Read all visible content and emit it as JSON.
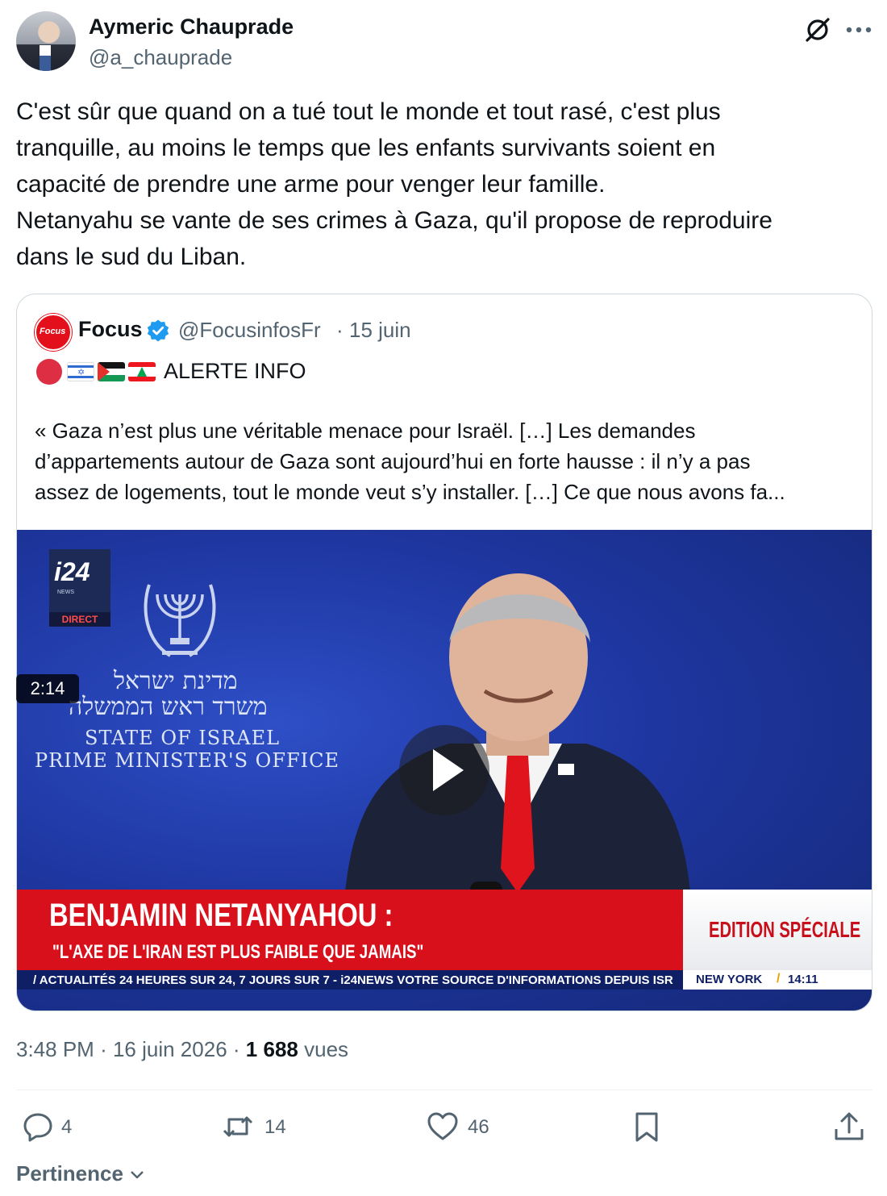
{
  "author": {
    "name": "Aymeric Chauprade",
    "handle": "@a_chauprade"
  },
  "header_icons": [
    "grok-icon",
    "more-icon"
  ],
  "tweet": {
    "lines": [
      "C'est sûr que quand on a tué tout le monde et tout rasé, c'est plus",
      "tranquille, au moins le temps que les enfants survivants soient en",
      "capacité de prendre une arme pour venger leur famille.",
      "Netanyahu se vante de ses crimes à Gaza, qu'il propose de reproduire",
      "dans le sud du Liban."
    ]
  },
  "quoted": {
    "avatar_text": "Focus",
    "name": "Focus",
    "handle": "@FocusinfosFr",
    "separator": "·",
    "date": "15 juin",
    "alert_label": "ALERTE INFO",
    "flags": [
      "red-circle",
      "israel-flag",
      "palestine-flag",
      "lebanon-flag"
    ],
    "quote_lines": [
      "« Gaza n’est plus une véritable menace pour Israël. […] Les demandes",
      "d’appartements autour de Gaza sont aujourd’hui en forte hausse : il n’y a pas",
      "assez de logements, tout le monde veut s’y installer. […] Ce que nous avons fa..."
    ],
    "video": {
      "logo": "i24",
      "logo_sub": "NEWS",
      "logo_direct": "DIRECT",
      "hebrew_line_1": "מדינת ישראל",
      "hebrew_line_2": "משרד ראש הממשלה",
      "state_line": "STATE OF ISRAEL",
      "office_line": "PRIME MINISTER'S OFFICE",
      "banner_title": "BENJAMIN NETANYAHOU :",
      "banner_subtitle": "\"L'AXE DE L'IRAN EST PLUS FAIBLE QUE JAMAIS\"",
      "edition": "EDITION SPÉCIALE",
      "ticker": "/ ACTUALITÉS 24 HEURES SUR 24, 7 JOURS SUR 7 - i24NEWS VOTRE SOURCE D'INFORMATIONS DEPUIS ISR",
      "ticker_city": "NEW YORK",
      "ticker_slash": "/",
      "ticker_time": "14:11",
      "duration": "2:14"
    }
  },
  "meta": {
    "time": "3:48 PM",
    "sep1": "·",
    "date": "16 juin 2026",
    "sep2": "·",
    "views_count": "1 688",
    "views_label": "vues"
  },
  "actions": {
    "replies": "4",
    "reposts": "14",
    "likes": "46"
  },
  "sort_label": "Pertinence",
  "colors": {
    "text": "#0f1419",
    "secondary": "#536471",
    "verified": "#1d9bf0",
    "border": "#cfd9de"
  }
}
